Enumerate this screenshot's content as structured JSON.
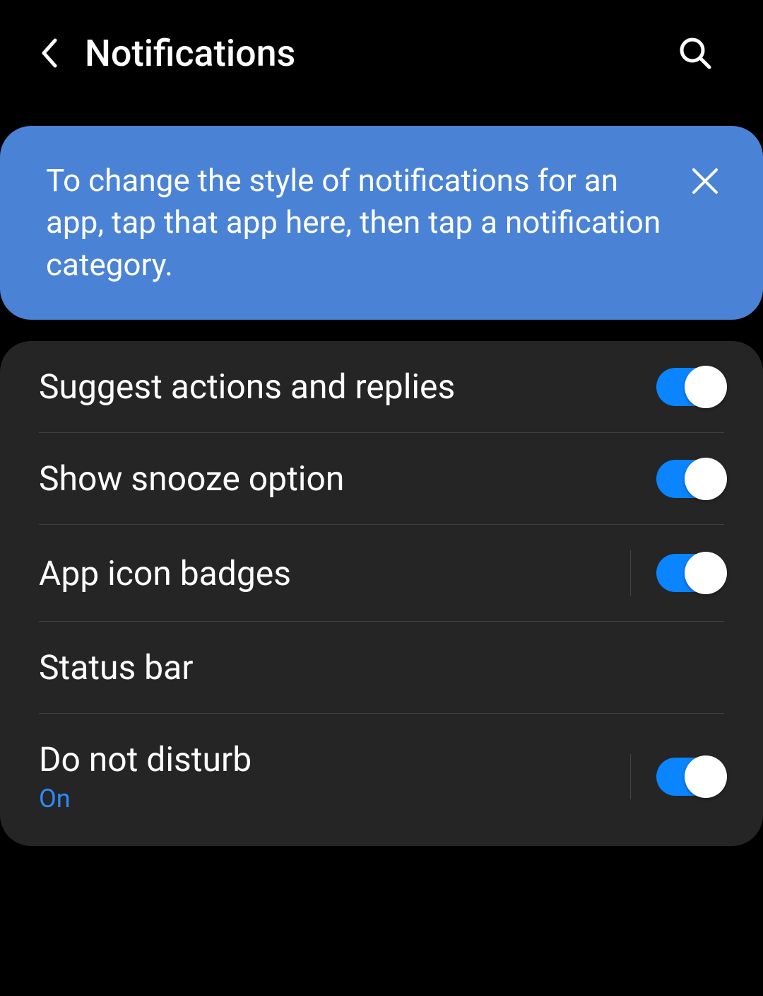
{
  "header": {
    "title": "Notifications"
  },
  "banner": {
    "text": "To change the style of notifications for an app, tap that app here, then tap a notification category."
  },
  "settings": {
    "items": [
      {
        "label": "Suggest actions and replies",
        "status": "",
        "toggle": true,
        "toggle_on": true,
        "vdiv": false
      },
      {
        "label": "Show snooze option",
        "status": "",
        "toggle": true,
        "toggle_on": true,
        "vdiv": false
      },
      {
        "label": "App icon badges",
        "status": "",
        "toggle": true,
        "toggle_on": true,
        "vdiv": true
      },
      {
        "label": "Status bar",
        "status": "",
        "toggle": false,
        "toggle_on": false,
        "vdiv": false
      },
      {
        "label": "Do not disturb",
        "status": "On",
        "toggle": true,
        "toggle_on": true,
        "vdiv": true
      }
    ]
  }
}
